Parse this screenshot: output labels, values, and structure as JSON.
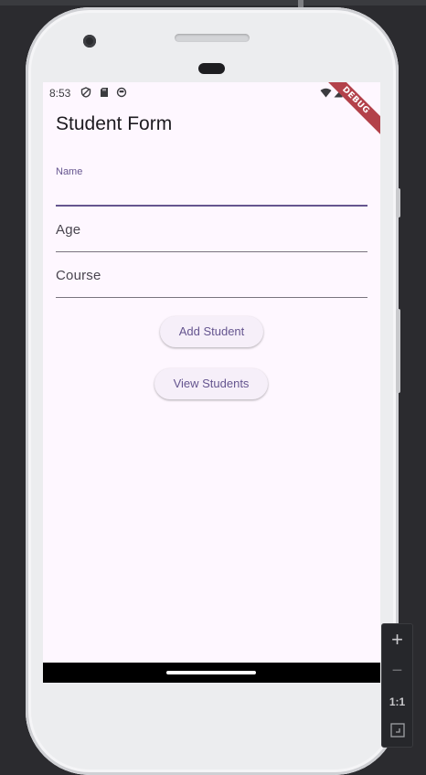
{
  "status_bar": {
    "time": "8:53",
    "left_icons": [
      "privacy-shield-icon",
      "sd-card-icon",
      "face-icon"
    ],
    "right_icons": [
      "wifi-icon",
      "signal-icon",
      "battery-icon"
    ]
  },
  "debug_banner": "DEBUG",
  "app": {
    "title": "Student Form",
    "fields": [
      {
        "label": "Name",
        "value": "",
        "focused": true
      },
      {
        "label": "Age",
        "value": "",
        "focused": false
      },
      {
        "label": "Course",
        "value": "",
        "focused": false
      }
    ],
    "buttons": {
      "add": "Add Student",
      "view": "View Students"
    }
  },
  "emulator_toolbar": {
    "zoom_in": "+",
    "zoom_out": "−",
    "actual_size": "1:1",
    "fit_icon": "fit-screen-icon"
  },
  "colors": {
    "primary": "#65558f",
    "background": "#fef7ff",
    "button_bg": "#f6eff9",
    "debug_ribbon": "#b3414a"
  }
}
